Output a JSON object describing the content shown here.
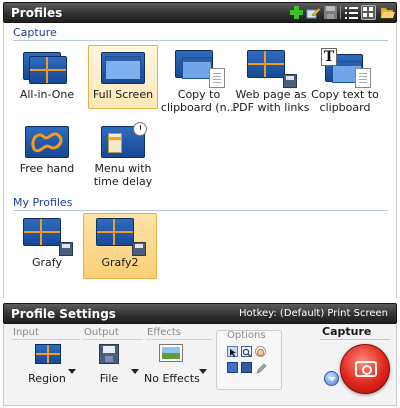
{
  "profiles_panel": {
    "title": "Profiles",
    "toolbar": [
      {
        "icon": "add-icon"
      },
      {
        "icon": "edit-icon"
      },
      {
        "icon": "save-icon"
      },
      {
        "icon": "list-view-icon"
      },
      {
        "icon": "grid-view-icon"
      },
      {
        "icon": "open-folder-icon"
      }
    ],
    "capture_section": "Capture",
    "capture_items": [
      {
        "label": "All-in-One"
      },
      {
        "label": "Full Screen"
      },
      {
        "label": "Copy to clipboard (n..."
      },
      {
        "label": "Web page as PDF with links"
      },
      {
        "label": "Copy text to clipboard"
      },
      {
        "label": "Free hand"
      },
      {
        "label": "Menu with time delay"
      }
    ],
    "my_profiles_section": "My Profiles",
    "my_items": [
      {
        "label": "Grafy"
      },
      {
        "label": "Grafy2"
      }
    ]
  },
  "settings": {
    "title": "Profile Settings",
    "hotkey": "Hotkey: (Default) Print Screen",
    "input": {
      "header": "Input",
      "value": "Region"
    },
    "output": {
      "header": "Output",
      "value": "File"
    },
    "effects": {
      "header": "Effects",
      "value": "No Effects"
    },
    "options": {
      "header": "Options"
    },
    "capture": {
      "header": "Capture"
    }
  },
  "colors": {
    "header_bg": "#2f2f2f",
    "section_text": "#1c3f9a",
    "selected_bg": "#fbcf76",
    "capture_red": "#e0261b",
    "grid_orange": "#f59a1f"
  }
}
